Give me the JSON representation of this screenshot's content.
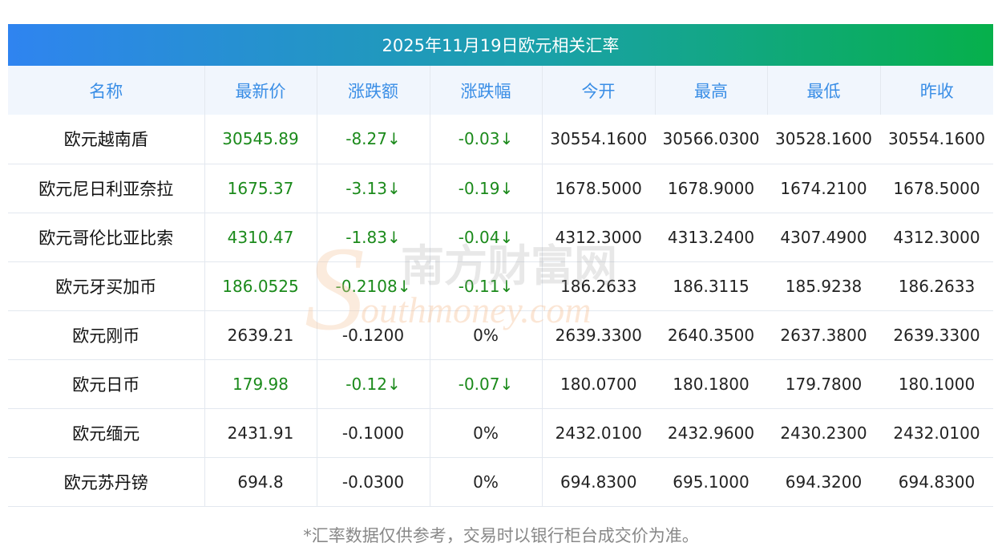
{
  "title": "2025年11月19日欧元相关汇率",
  "headers": [
    "名称",
    "最新价",
    "涨跌额",
    "涨跌幅",
    "今开",
    "最高",
    "最低",
    "昨收"
  ],
  "rows": [
    {
      "name": "欧元越南盾",
      "latest": "30545.89",
      "change": "-8.27↓",
      "pct": "-0.03↓",
      "open": "30554.1600",
      "high": "30566.0300",
      "low": "30528.1600",
      "prev": "30554.1600",
      "down": true
    },
    {
      "name": "欧元尼日利亚奈拉",
      "latest": "1675.37",
      "change": "-3.13↓",
      "pct": "-0.19↓",
      "open": "1678.5000",
      "high": "1678.9000",
      "low": "1674.2100",
      "prev": "1678.5000",
      "down": true
    },
    {
      "name": "欧元哥伦比亚比索",
      "latest": "4310.47",
      "change": "-1.83↓",
      "pct": "-0.04↓",
      "open": "4312.3000",
      "high": "4313.2400",
      "low": "4307.4900",
      "prev": "4312.3000",
      "down": true
    },
    {
      "name": "欧元牙买加币",
      "latest": "186.0525",
      "change": "-0.2108↓",
      "pct": "-0.11↓",
      "open": "186.2633",
      "high": "186.3115",
      "low": "185.9238",
      "prev": "186.2633",
      "down": true
    },
    {
      "name": "欧元刚币",
      "latest": "2639.21",
      "change": "-0.1200",
      "pct": "0%",
      "open": "2639.3300",
      "high": "2640.3500",
      "low": "2637.3800",
      "prev": "2639.3300",
      "down": false
    },
    {
      "name": "欧元日币",
      "latest": "179.98",
      "change": "-0.12↓",
      "pct": "-0.07↓",
      "open": "180.0700",
      "high": "180.1800",
      "low": "179.7800",
      "prev": "180.1000",
      "down": true
    },
    {
      "name": "欧元缅元",
      "latest": "2431.91",
      "change": "-0.1000",
      "pct": "0%",
      "open": "2432.0100",
      "high": "2432.9600",
      "low": "2430.2300",
      "prev": "2432.0100",
      "down": false
    },
    {
      "name": "欧元苏丹镑",
      "latest": "694.8",
      "change": "-0.0300",
      "pct": "0%",
      "open": "694.8300",
      "high": "695.1000",
      "low": "694.3200",
      "prev": "694.8300",
      "down": false
    }
  ],
  "note": "*汇率数据仅供参考，交易时以银行柜台成交价为准。",
  "watermark": {
    "cn": "南方财富网",
    "en": "outhmoney.com",
    "letter": "S"
  },
  "colors": {
    "accent": "#3a8ee6",
    "down": "#1b8a1b",
    "gradient_start": "#2f84f0",
    "gradient_end": "#06b04b"
  }
}
